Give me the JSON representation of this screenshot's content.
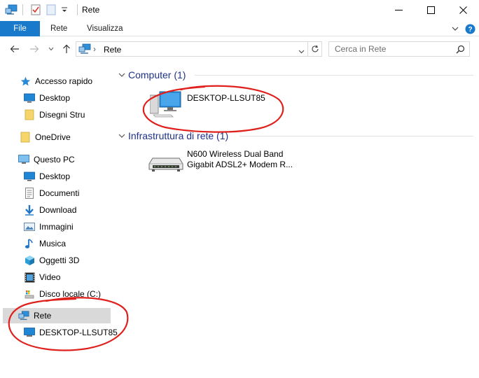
{
  "window": {
    "title": "Rete",
    "minimize_glyph": "–",
    "maximize_glyph": "☐",
    "close_glyph": "✕"
  },
  "ribbon": {
    "tabs": [
      {
        "label": "File",
        "active": true
      },
      {
        "label": "Rete",
        "active": false
      },
      {
        "label": "Visualizza",
        "active": false
      }
    ]
  },
  "address_bar": {
    "path_separator": "›",
    "path": "Rete"
  },
  "search": {
    "placeholder": "Cerca in Rete"
  },
  "navigation": {
    "items": [
      {
        "label": "Accesso rapido",
        "icon": "star-icon"
      },
      {
        "label": "Desktop",
        "icon": "desktop-icon"
      },
      {
        "label": "Disegni Stru",
        "icon": "folder-icon"
      },
      {
        "label": "OneDrive",
        "icon": "folder-icon"
      },
      {
        "label": "Questo PC",
        "icon": "computer-icon"
      },
      {
        "label": "Desktop",
        "icon": "desktop-icon"
      },
      {
        "label": "Documenti",
        "icon": "document-icon"
      },
      {
        "label": "Download",
        "icon": "download-icon"
      },
      {
        "label": "Immagini",
        "icon": "pictures-icon"
      },
      {
        "label": "Musica",
        "icon": "music-icon"
      },
      {
        "label": "Oggetti 3D",
        "icon": "cube-icon"
      },
      {
        "label": "Video",
        "icon": "video-icon"
      },
      {
        "label": "Disco locale (C:)",
        "icon": "drive-icon"
      },
      {
        "label": "Rete",
        "icon": "network-icon",
        "selected": true
      },
      {
        "label": "DESKTOP-LLSUT85",
        "icon": "computer-icon"
      }
    ]
  },
  "content": {
    "groups": [
      {
        "title": "Computer (1)",
        "items": [
          {
            "label_lines": [
              "DESKTOP-LLSUT85"
            ],
            "icon": "computer-icon"
          }
        ]
      },
      {
        "title": "Infrastruttura di rete (1)",
        "items": [
          {
            "label_lines": [
              "N600 Wireless Dual Band",
              "Gigabit ADSL2+ Modem R..."
            ],
            "icon": "router-icon"
          }
        ]
      }
    ]
  },
  "colors": {
    "accent": "#1979ca",
    "group_title": "#1e3287",
    "annotation": "#e0201c",
    "selected_bg": "#d9d9d9"
  }
}
